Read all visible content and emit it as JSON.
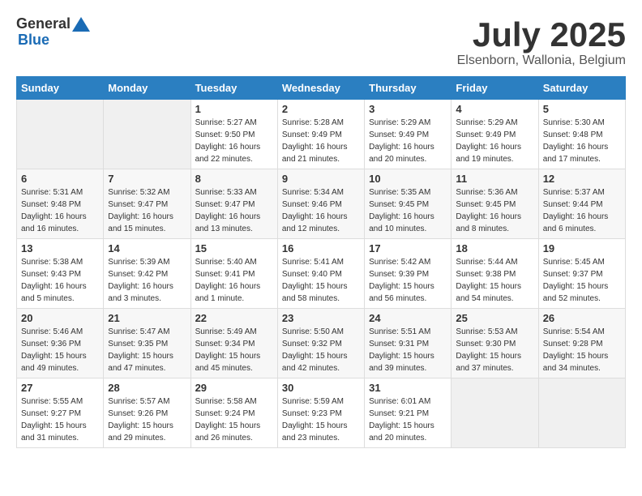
{
  "logo": {
    "general": "General",
    "blue": "Blue"
  },
  "title": "July 2025",
  "location": "Elsenborn, Wallonia, Belgium",
  "weekdays": [
    "Sunday",
    "Monday",
    "Tuesday",
    "Wednesday",
    "Thursday",
    "Friday",
    "Saturday"
  ],
  "weeks": [
    [
      {
        "day": "",
        "sunrise": "",
        "sunset": "",
        "daylight": ""
      },
      {
        "day": "",
        "sunrise": "",
        "sunset": "",
        "daylight": ""
      },
      {
        "day": "1",
        "sunrise": "Sunrise: 5:27 AM",
        "sunset": "Sunset: 9:50 PM",
        "daylight": "Daylight: 16 hours and 22 minutes."
      },
      {
        "day": "2",
        "sunrise": "Sunrise: 5:28 AM",
        "sunset": "Sunset: 9:49 PM",
        "daylight": "Daylight: 16 hours and 21 minutes."
      },
      {
        "day": "3",
        "sunrise": "Sunrise: 5:29 AM",
        "sunset": "Sunset: 9:49 PM",
        "daylight": "Daylight: 16 hours and 20 minutes."
      },
      {
        "day": "4",
        "sunrise": "Sunrise: 5:29 AM",
        "sunset": "Sunset: 9:49 PM",
        "daylight": "Daylight: 16 hours and 19 minutes."
      },
      {
        "day": "5",
        "sunrise": "Sunrise: 5:30 AM",
        "sunset": "Sunset: 9:48 PM",
        "daylight": "Daylight: 16 hours and 17 minutes."
      }
    ],
    [
      {
        "day": "6",
        "sunrise": "Sunrise: 5:31 AM",
        "sunset": "Sunset: 9:48 PM",
        "daylight": "Daylight: 16 hours and 16 minutes."
      },
      {
        "day": "7",
        "sunrise": "Sunrise: 5:32 AM",
        "sunset": "Sunset: 9:47 PM",
        "daylight": "Daylight: 16 hours and 15 minutes."
      },
      {
        "day": "8",
        "sunrise": "Sunrise: 5:33 AM",
        "sunset": "Sunset: 9:47 PM",
        "daylight": "Daylight: 16 hours and 13 minutes."
      },
      {
        "day": "9",
        "sunrise": "Sunrise: 5:34 AM",
        "sunset": "Sunset: 9:46 PM",
        "daylight": "Daylight: 16 hours and 12 minutes."
      },
      {
        "day": "10",
        "sunrise": "Sunrise: 5:35 AM",
        "sunset": "Sunset: 9:45 PM",
        "daylight": "Daylight: 16 hours and 10 minutes."
      },
      {
        "day": "11",
        "sunrise": "Sunrise: 5:36 AM",
        "sunset": "Sunset: 9:45 PM",
        "daylight": "Daylight: 16 hours and 8 minutes."
      },
      {
        "day": "12",
        "sunrise": "Sunrise: 5:37 AM",
        "sunset": "Sunset: 9:44 PM",
        "daylight": "Daylight: 16 hours and 6 minutes."
      }
    ],
    [
      {
        "day": "13",
        "sunrise": "Sunrise: 5:38 AM",
        "sunset": "Sunset: 9:43 PM",
        "daylight": "Daylight: 16 hours and 5 minutes."
      },
      {
        "day": "14",
        "sunrise": "Sunrise: 5:39 AM",
        "sunset": "Sunset: 9:42 PM",
        "daylight": "Daylight: 16 hours and 3 minutes."
      },
      {
        "day": "15",
        "sunrise": "Sunrise: 5:40 AM",
        "sunset": "Sunset: 9:41 PM",
        "daylight": "Daylight: 16 hours and 1 minute."
      },
      {
        "day": "16",
        "sunrise": "Sunrise: 5:41 AM",
        "sunset": "Sunset: 9:40 PM",
        "daylight": "Daylight: 15 hours and 58 minutes."
      },
      {
        "day": "17",
        "sunrise": "Sunrise: 5:42 AM",
        "sunset": "Sunset: 9:39 PM",
        "daylight": "Daylight: 15 hours and 56 minutes."
      },
      {
        "day": "18",
        "sunrise": "Sunrise: 5:44 AM",
        "sunset": "Sunset: 9:38 PM",
        "daylight": "Daylight: 15 hours and 54 minutes."
      },
      {
        "day": "19",
        "sunrise": "Sunrise: 5:45 AM",
        "sunset": "Sunset: 9:37 PM",
        "daylight": "Daylight: 15 hours and 52 minutes."
      }
    ],
    [
      {
        "day": "20",
        "sunrise": "Sunrise: 5:46 AM",
        "sunset": "Sunset: 9:36 PM",
        "daylight": "Daylight: 15 hours and 49 minutes."
      },
      {
        "day": "21",
        "sunrise": "Sunrise: 5:47 AM",
        "sunset": "Sunset: 9:35 PM",
        "daylight": "Daylight: 15 hours and 47 minutes."
      },
      {
        "day": "22",
        "sunrise": "Sunrise: 5:49 AM",
        "sunset": "Sunset: 9:34 PM",
        "daylight": "Daylight: 15 hours and 45 minutes."
      },
      {
        "day": "23",
        "sunrise": "Sunrise: 5:50 AM",
        "sunset": "Sunset: 9:32 PM",
        "daylight": "Daylight: 15 hours and 42 minutes."
      },
      {
        "day": "24",
        "sunrise": "Sunrise: 5:51 AM",
        "sunset": "Sunset: 9:31 PM",
        "daylight": "Daylight: 15 hours and 39 minutes."
      },
      {
        "day": "25",
        "sunrise": "Sunrise: 5:53 AM",
        "sunset": "Sunset: 9:30 PM",
        "daylight": "Daylight: 15 hours and 37 minutes."
      },
      {
        "day": "26",
        "sunrise": "Sunrise: 5:54 AM",
        "sunset": "Sunset: 9:28 PM",
        "daylight": "Daylight: 15 hours and 34 minutes."
      }
    ],
    [
      {
        "day": "27",
        "sunrise": "Sunrise: 5:55 AM",
        "sunset": "Sunset: 9:27 PM",
        "daylight": "Daylight: 15 hours and 31 minutes."
      },
      {
        "day": "28",
        "sunrise": "Sunrise: 5:57 AM",
        "sunset": "Sunset: 9:26 PM",
        "daylight": "Daylight: 15 hours and 29 minutes."
      },
      {
        "day": "29",
        "sunrise": "Sunrise: 5:58 AM",
        "sunset": "Sunset: 9:24 PM",
        "daylight": "Daylight: 15 hours and 26 minutes."
      },
      {
        "day": "30",
        "sunrise": "Sunrise: 5:59 AM",
        "sunset": "Sunset: 9:23 PM",
        "daylight": "Daylight: 15 hours and 23 minutes."
      },
      {
        "day": "31",
        "sunrise": "Sunrise: 6:01 AM",
        "sunset": "Sunset: 9:21 PM",
        "daylight": "Daylight: 15 hours and 20 minutes."
      },
      {
        "day": "",
        "sunrise": "",
        "sunset": "",
        "daylight": ""
      },
      {
        "day": "",
        "sunrise": "",
        "sunset": "",
        "daylight": ""
      }
    ]
  ]
}
